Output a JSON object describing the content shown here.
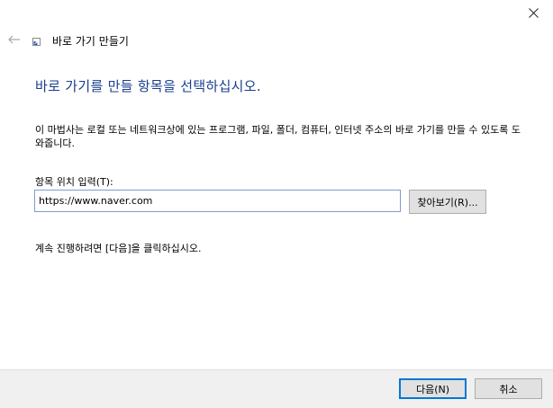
{
  "window": {
    "title": "바로 가기 만들기",
    "close_icon": "close-icon",
    "back_icon": "back-arrow-icon",
    "wizard_icon": "shortcut-wizard-icon"
  },
  "content": {
    "heading": "바로 가기를 만들 항목을 선택하십시오.",
    "description": "이 마법사는 로컬 또는 네트워크상에 있는 프로그램, 파일, 폴더, 컴퓨터, 인터넷 주소의 바로 가기를 만들 수 있도록 도와줍니다.",
    "location_label": "항목 위치 입력(T):",
    "location_value": "https://www.naver.com",
    "browse_label": "찾아보기(R)...",
    "continue_text": "계속 진행하려면 [다음]을 클릭하십시오."
  },
  "footer": {
    "next_label": "다음(N)",
    "cancel_label": "취소"
  },
  "colors": {
    "heading": "#1a3e8c",
    "footer_bg": "#f0f0f0",
    "button_bg": "#e1e1e1",
    "default_button_border": "#0078d7",
    "input_border": "#7a9cd3"
  }
}
